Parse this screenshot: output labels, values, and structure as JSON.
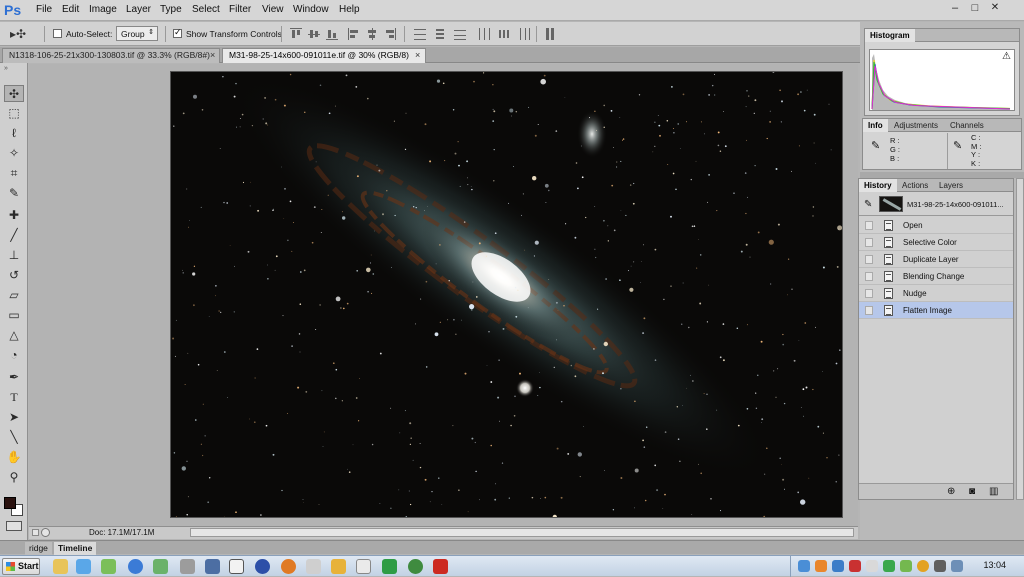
{
  "app": {
    "logo": "Ps",
    "menu": [
      "File",
      "Edit",
      "Image",
      "Layer",
      "Type",
      "Select",
      "Filter",
      "View",
      "Window",
      "Help"
    ],
    "window_controls": [
      "–",
      "□",
      "✕"
    ]
  },
  "options_bar": {
    "auto_select_label": "Auto-Select:",
    "auto_select_checked": false,
    "group_value": "Group",
    "show_transform_label": "Show Transform Controls",
    "show_transform_checked": true
  },
  "document_tabs": [
    {
      "label": "N1318-106-25-21x300-130803.tif @ 33.3% (RGB/8#)",
      "active": false,
      "close": "×"
    },
    {
      "label": "M31-98-25-14x600-091011e.tif @ 30% (RGB/8)",
      "active": true,
      "close": "×"
    }
  ],
  "tools": [
    "move-tool",
    "marquee-tool",
    "lasso-tool",
    "quick-select-tool",
    "crop-tool",
    "eyedropper-tool",
    "healing-brush-tool",
    "brush-tool",
    "clone-stamp-tool",
    "history-brush-tool",
    "eraser-tool",
    "gradient-tool",
    "blur-tool",
    "dodge-tool",
    "pen-tool",
    "type-tool",
    "path-select-tool",
    "line-tool",
    "hand-tool",
    "zoom-tool"
  ],
  "colors": {
    "foreground": "#2a120f",
    "background": "#ffffff",
    "selected_row": "#b6c7ea",
    "app_accent": "#2d6fd3"
  },
  "status_bar": {
    "doc_info": "Doc: 17.1M/17.1M"
  },
  "bottom_tabs": [
    "ridge",
    "Timeline"
  ],
  "panels": {
    "histogram": {
      "tab": "Histogram",
      "warning": "⚠"
    },
    "info": {
      "tabs": [
        "Info",
        "Adjustments",
        "Channels"
      ],
      "rgb_labels": [
        "R :",
        "G :",
        "B :"
      ],
      "cmyk_labels": [
        "C :",
        "M :",
        "Y :",
        "K :"
      ]
    },
    "history": {
      "tabs": [
        "History",
        "Actions",
        "Layers"
      ],
      "snapshot_label": "M31-98-25-14x600-091011...",
      "states": [
        "Open",
        "Selective Color",
        "Duplicate Layer",
        "Blending Change",
        "Nudge",
        "Flatten Image"
      ],
      "selected_index": 5
    }
  },
  "taskbar": {
    "start_label": "Start",
    "clock": "13:04"
  }
}
